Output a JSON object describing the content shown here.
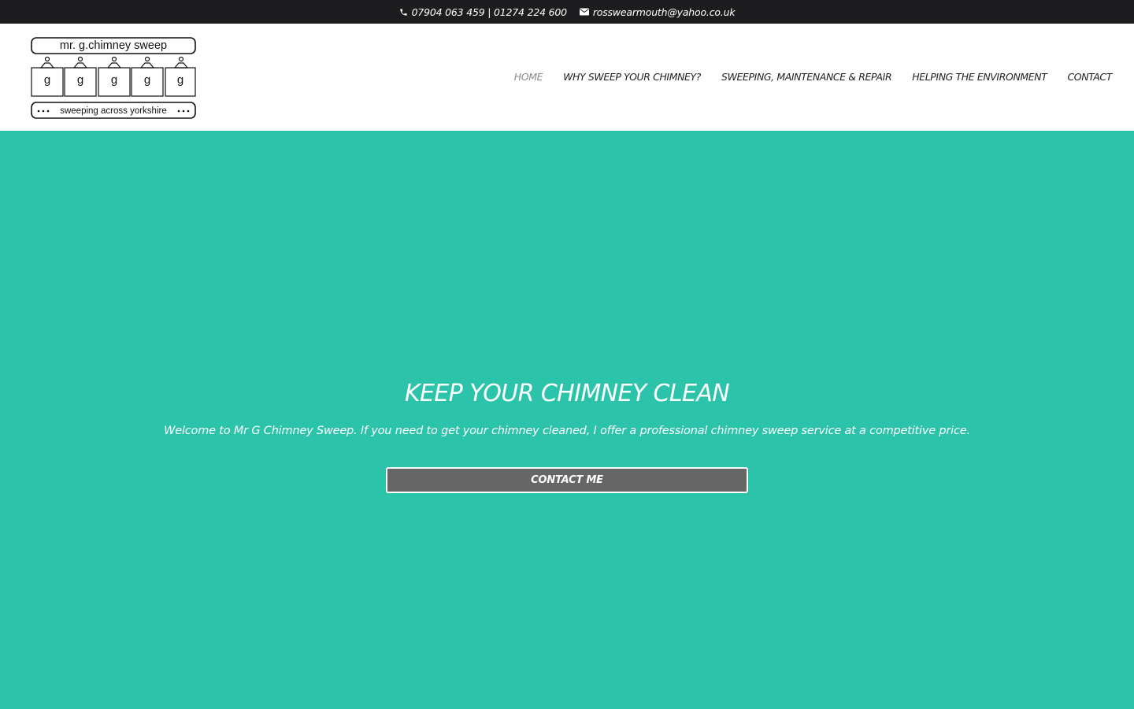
{
  "topbar": {
    "phone": "07904 063 459 | 01274 224 600",
    "email": "rosswearmouth@yahoo.co.uk",
    "phone_icon": "phone-icon",
    "email_icon": "envelope-icon"
  },
  "logo": {
    "title": "mr. g.chimney sweep",
    "bag_letter": "g",
    "tagline": "sweeping across yorkshire"
  },
  "nav": {
    "items": [
      {
        "label": "HOME",
        "active": true
      },
      {
        "label": "WHY SWEEP YOUR CHIMNEY?",
        "active": false
      },
      {
        "label": "SWEEPING, MAINTENANCE & REPAIR",
        "active": false
      },
      {
        "label": "HELPING THE ENVIRONMENT",
        "active": false
      },
      {
        "label": "CONTACT",
        "active": false
      }
    ]
  },
  "hero": {
    "heading": "KEEP YOUR CHIMNEY CLEAN",
    "text": "Welcome to Mr G Chimney Sweep. If you need to get your chimney cleaned, I offer a professional chimney sweep service at a competitive price.",
    "button_label": "CONTACT ME"
  },
  "colors": {
    "topbar_bg": "#1d1d1f",
    "hero_bg": "#2bc4ab",
    "button_bg": "#666666",
    "nav_active": "#8a8a8a"
  }
}
